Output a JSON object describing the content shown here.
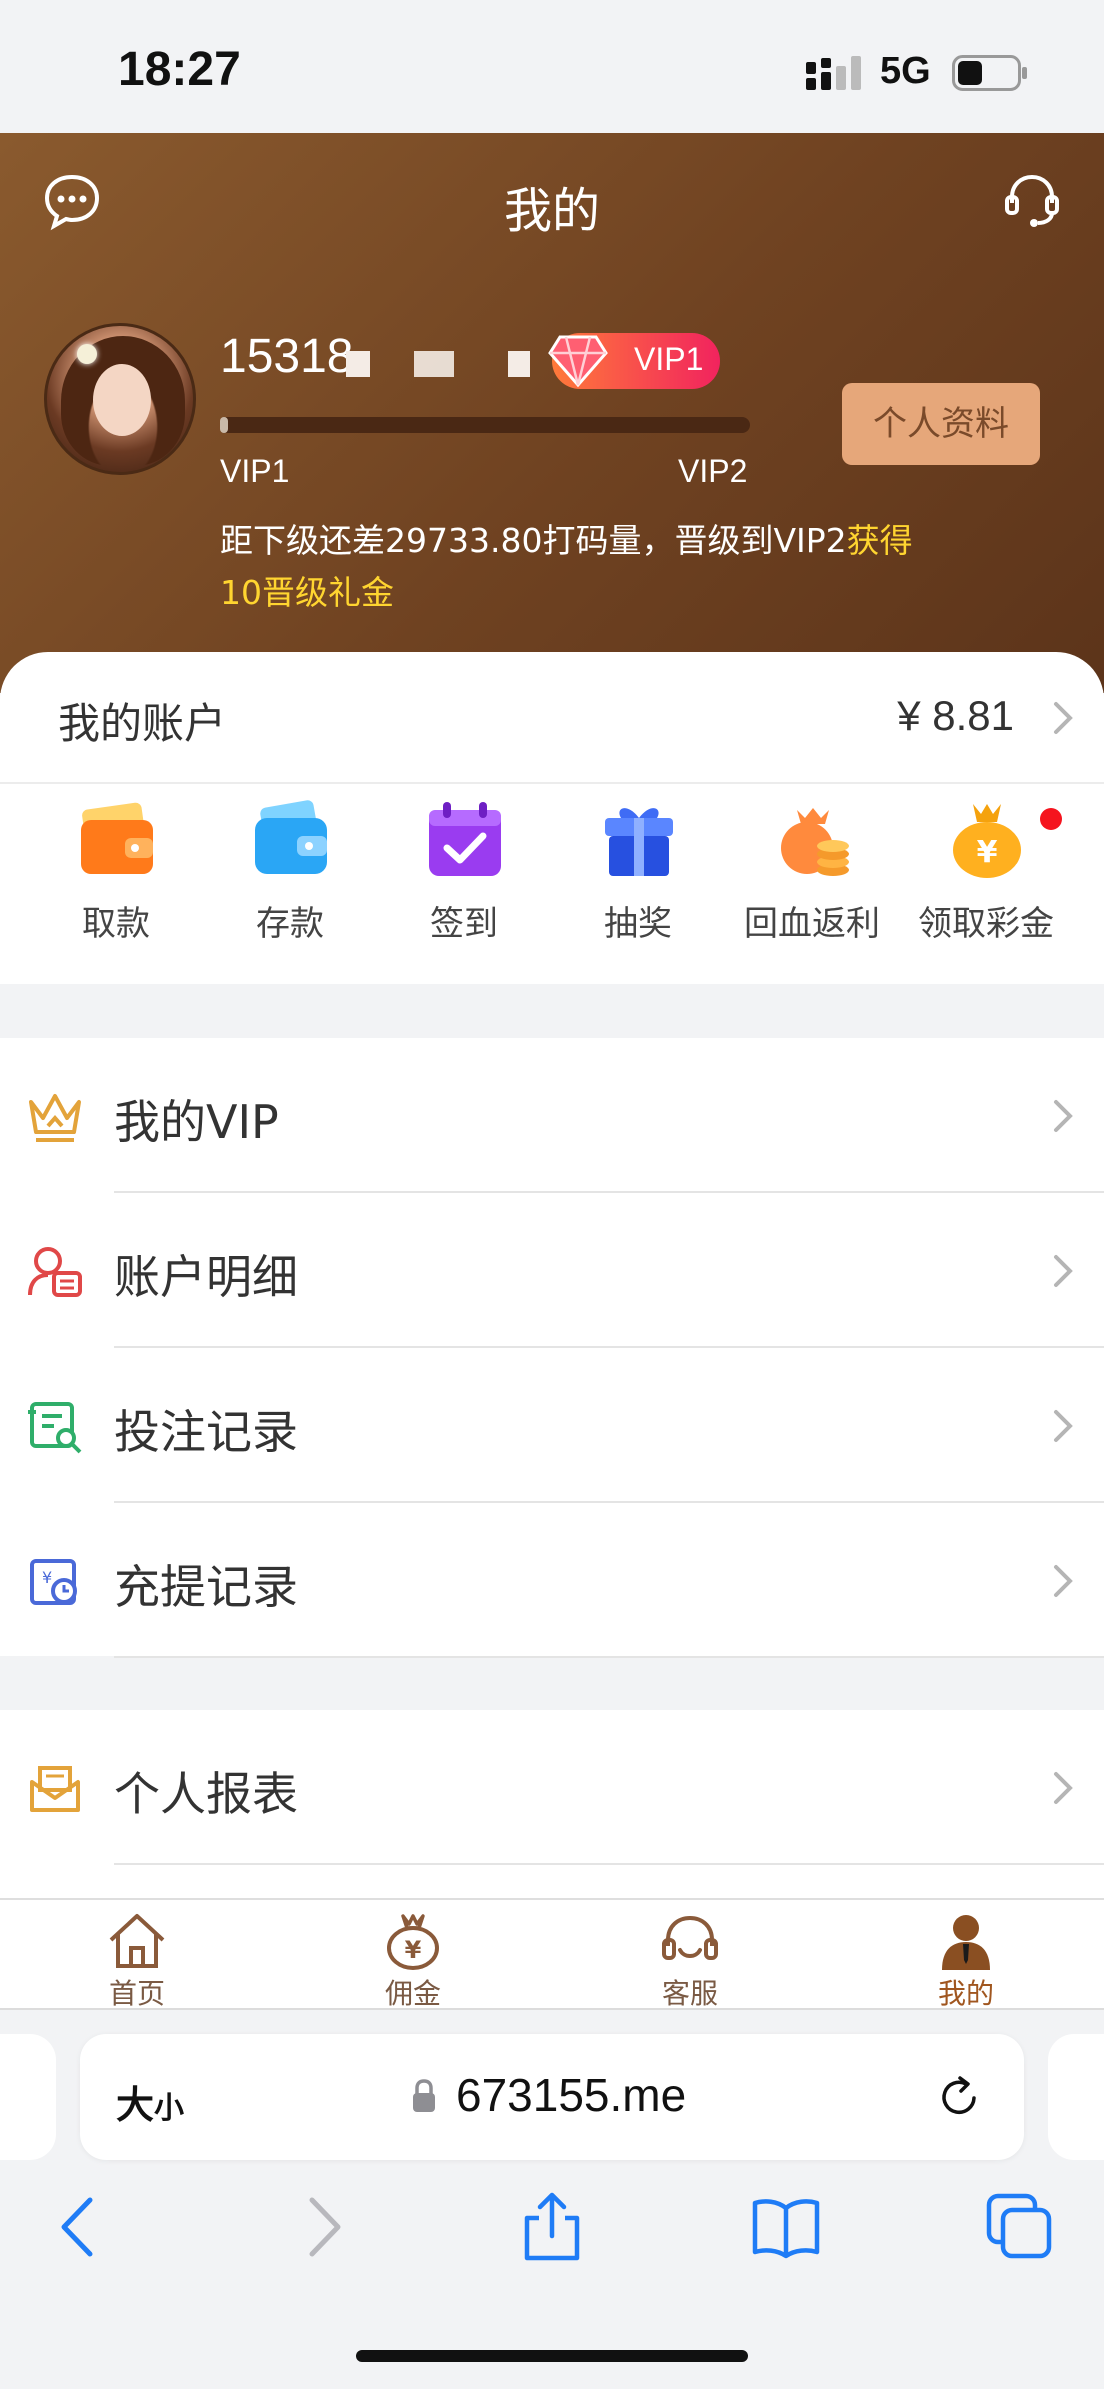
{
  "status_bar": {
    "time": "18:27",
    "network": "5G"
  },
  "header": {
    "title": "我的",
    "username": "15318",
    "vip_badge": "VIP1",
    "progress_fraction": 0.01,
    "vip_current": "VIP1",
    "vip_next": "VIP2",
    "upgrade_text": "距下级还差29733.80打码量，晋级到VIP2",
    "upgrade_reward": "获得10晋级礼金",
    "profile_button": "个人资料"
  },
  "account": {
    "label": "我的账户",
    "balance": "¥ 8.81"
  },
  "quick_actions": [
    {
      "label": "取款",
      "icon": "wallet-orange-icon"
    },
    {
      "label": "存款",
      "icon": "wallet-blue-icon"
    },
    {
      "label": "签到",
      "icon": "calendar-check-icon"
    },
    {
      "label": "抽奖",
      "icon": "gift-icon"
    },
    {
      "label": "回血返利",
      "icon": "money-bag-coins-icon"
    },
    {
      "label": "领取彩金",
      "icon": "yen-bag-icon"
    }
  ],
  "menu_group_1": [
    {
      "label": "我的VIP",
      "icon": "crown-icon"
    },
    {
      "label": "账户明细",
      "icon": "user-detail-icon"
    },
    {
      "label": "投注记录",
      "icon": "bet-record-icon"
    },
    {
      "label": "充提记录",
      "icon": "deposit-record-icon"
    }
  ],
  "menu_group_2": [
    {
      "label": "个人报表",
      "icon": "envelope-report-icon"
    }
  ],
  "tab_bar": [
    {
      "label": "首页",
      "icon": "home-icon"
    },
    {
      "label": "佣金",
      "icon": "money-bag-icon"
    },
    {
      "label": "客服",
      "icon": "headset-icon"
    },
    {
      "label": "我的",
      "icon": "user-icon",
      "active": true
    }
  ],
  "browser": {
    "text_size": "大",
    "text_size_small": "小",
    "url": "673155.me"
  },
  "colors": {
    "header_brown": "#6f4221",
    "highlight_yellow": "#ffd530",
    "profile_button": "#e6a77a",
    "tab_active": "#a0561f",
    "ios_blue": "#1f7cf6"
  }
}
